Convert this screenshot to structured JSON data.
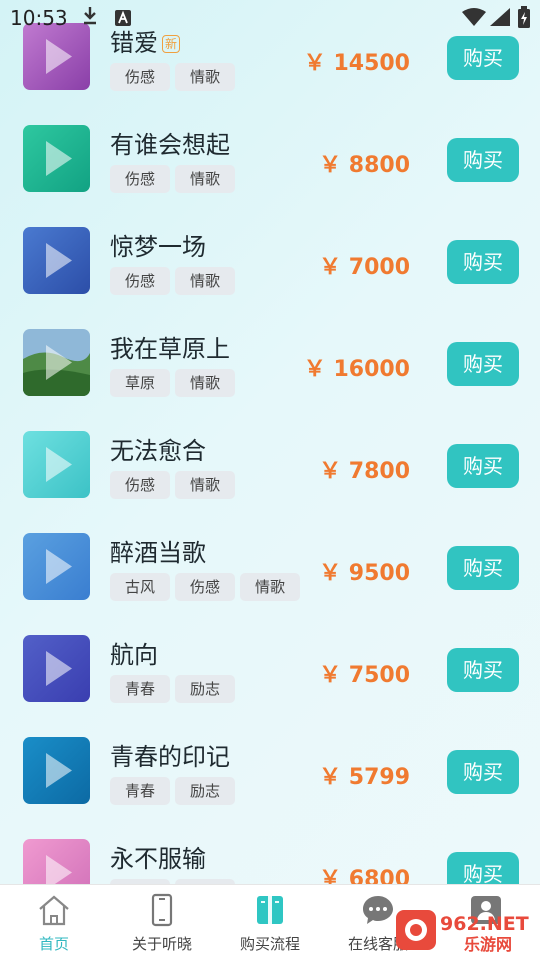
{
  "status": {
    "time": "10:53"
  },
  "songs": [
    {
      "title": "错爱",
      "is_new": true,
      "new_label": "新",
      "tags": [
        "伤感",
        "情歌"
      ],
      "price": "￥ 14500",
      "buy": "购买",
      "thumb": [
        "#c07ad0",
        "#8a3fa8"
      ]
    },
    {
      "title": "有谁会想起",
      "is_new": false,
      "tags": [
        "伤感",
        "情歌"
      ],
      "price": "￥ 8800",
      "buy": "购买",
      "thumb": [
        "#2ec8a0",
        "#12a283"
      ]
    },
    {
      "title": "惊梦一场",
      "is_new": false,
      "tags": [
        "伤感",
        "情歌"
      ],
      "price": "￥ 7000",
      "buy": "购买",
      "thumb": [
        "#4a7ad0",
        "#2c4ea8"
      ]
    },
    {
      "title": "我在草原上",
      "is_new": false,
      "tags": [
        "草原",
        "情歌"
      ],
      "price": "￥ 16000",
      "buy": "购买",
      "thumb": [
        "#7ab0d8",
        "#3d7a3a"
      ],
      "photo": true
    },
    {
      "title": "无法愈合",
      "is_new": false,
      "tags": [
        "伤感",
        "情歌"
      ],
      "price": "￥ 7800",
      "buy": "购买",
      "thumb": [
        "#6ee0e0",
        "#3cc2c6"
      ]
    },
    {
      "title": "醉酒当歌",
      "is_new": false,
      "tags": [
        "古风",
        "伤感",
        "情歌"
      ],
      "price": "￥ 9500",
      "buy": "购买",
      "thumb": [
        "#5aa0e0",
        "#3a7ed0"
      ]
    },
    {
      "title": "航向",
      "is_new": false,
      "tags": [
        "青春",
        "励志"
      ],
      "price": "￥ 7500",
      "buy": "购买",
      "thumb": [
        "#5260c8",
        "#3a3eb0"
      ]
    },
    {
      "title": "青春的印记",
      "is_new": false,
      "tags": [
        "青春",
        "励志"
      ],
      "price": "￥ 5799",
      "buy": "购买",
      "thumb": [
        "#1a8ec8",
        "#0c6aa4"
      ]
    },
    {
      "title": "永不服输",
      "is_new": false,
      "tags": [
        "",
        ""
      ],
      "price": "￥ 6800",
      "buy": "购买",
      "thumb": [
        "#f09ad0",
        "#d070b8"
      ]
    }
  ],
  "tabbar": {
    "tabs": [
      {
        "label": "首页",
        "icon": "home-icon",
        "active": true
      },
      {
        "label": "关于听晓",
        "icon": "phone-icon",
        "active": false
      },
      {
        "label": "购买流程",
        "icon": "book-icon",
        "active": false
      },
      {
        "label": "在线客服",
        "icon": "chat-icon",
        "active": false
      },
      {
        "label": "",
        "icon": "user-icon",
        "active": false
      }
    ]
  },
  "watermark": {
    "text1": "962.NET",
    "text2": "乐游网"
  },
  "colors": {
    "accent": "#31c4c1",
    "price": "#f07a30",
    "active_tab": "#31b8c0"
  }
}
